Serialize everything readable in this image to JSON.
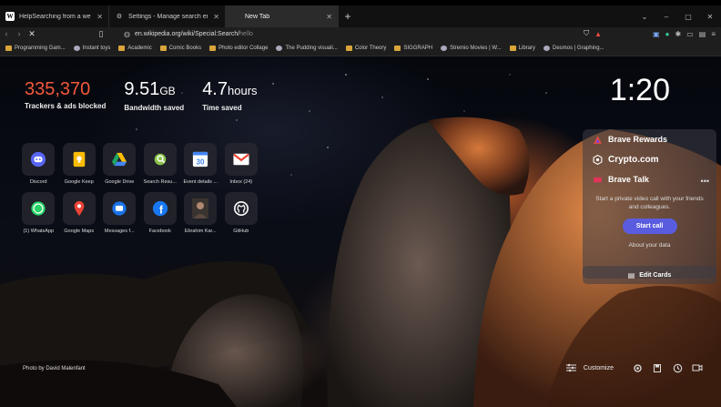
{
  "browser": {
    "tabs": [
      {
        "title": "HelpSearching from a web browser -",
        "icon": "wikipedia-icon",
        "active": false
      },
      {
        "title": "Settings - Manage search engines and",
        "icon": "gear-icon",
        "active": false
      },
      {
        "title": "New Tab",
        "icon": "",
        "active": true
      }
    ],
    "url": {
      "main": "en.wikipedia.org/wiki/Special:Search/",
      "typed": "hello"
    },
    "bookmarks": [
      {
        "label": "Programming Gam..."
      },
      {
        "label": "Instant toys"
      },
      {
        "label": "Academic"
      },
      {
        "label": "Comic Books"
      },
      {
        "label": "Photo editor Collage"
      },
      {
        "label": "The Pudding visuali..."
      },
      {
        "label": "Color Theory"
      },
      {
        "label": "SIGGRAPH"
      },
      {
        "label": "Stremio Movies | W..."
      },
      {
        "label": "Library"
      },
      {
        "label": "Desmos | Graphing..."
      }
    ]
  },
  "stats": [
    {
      "value": "335,370",
      "unit": "",
      "label": "Trackers & ads blocked",
      "color": "#f2593a"
    },
    {
      "value": "9.51",
      "unit": "GB",
      "label": "Bandwidth saved",
      "color": "#ffffff"
    },
    {
      "value": "4.7",
      "unit": "hours",
      "label": "Time saved",
      "color": "#ffffff"
    }
  ],
  "clock": "1:20",
  "top_sites": [
    {
      "name": "Discord",
      "icon": "discord-icon",
      "color": "#5865f2"
    },
    {
      "name": "Google Keep",
      "icon": "keep-icon",
      "color": "#fbbc04"
    },
    {
      "name": "Google Drive",
      "icon": "drive-icon",
      "color": "#1fa463"
    },
    {
      "name": "Search Resu...",
      "icon": "search-results-icon",
      "color": "#7cb342"
    },
    {
      "name": "Event details ...",
      "icon": "calendar-icon",
      "color": "#4285f4"
    },
    {
      "name": "Inbox (24)",
      "icon": "gmail-icon",
      "color": "#ea4335"
    },
    {
      "name": "(1) WhatsApp",
      "icon": "whatsapp-icon",
      "color": "#25d366"
    },
    {
      "name": "Google Maps",
      "icon": "maps-icon",
      "color": "#34a853"
    },
    {
      "name": "Messages f...",
      "icon": "messages-icon",
      "color": "#1a73e8"
    },
    {
      "name": "Facebook",
      "icon": "facebook-icon",
      "color": "#1877f2"
    },
    {
      "name": "Ebrahim Kar...",
      "icon": "profile-photo-icon",
      "color": "#8a6a50"
    },
    {
      "name": "GitHub",
      "icon": "github-icon",
      "color": "#ffffff"
    }
  ],
  "cards": {
    "rewards": "Brave Rewards",
    "crypto": "Crypto.com",
    "talk": "Brave Talk",
    "talk_desc": "Start a private video call with your friends and colleagues.",
    "start_call": "Start call",
    "about": "About your data",
    "edit": "Edit Cards"
  },
  "credit": "Photo by David Malenfant",
  "customize": "Customize"
}
